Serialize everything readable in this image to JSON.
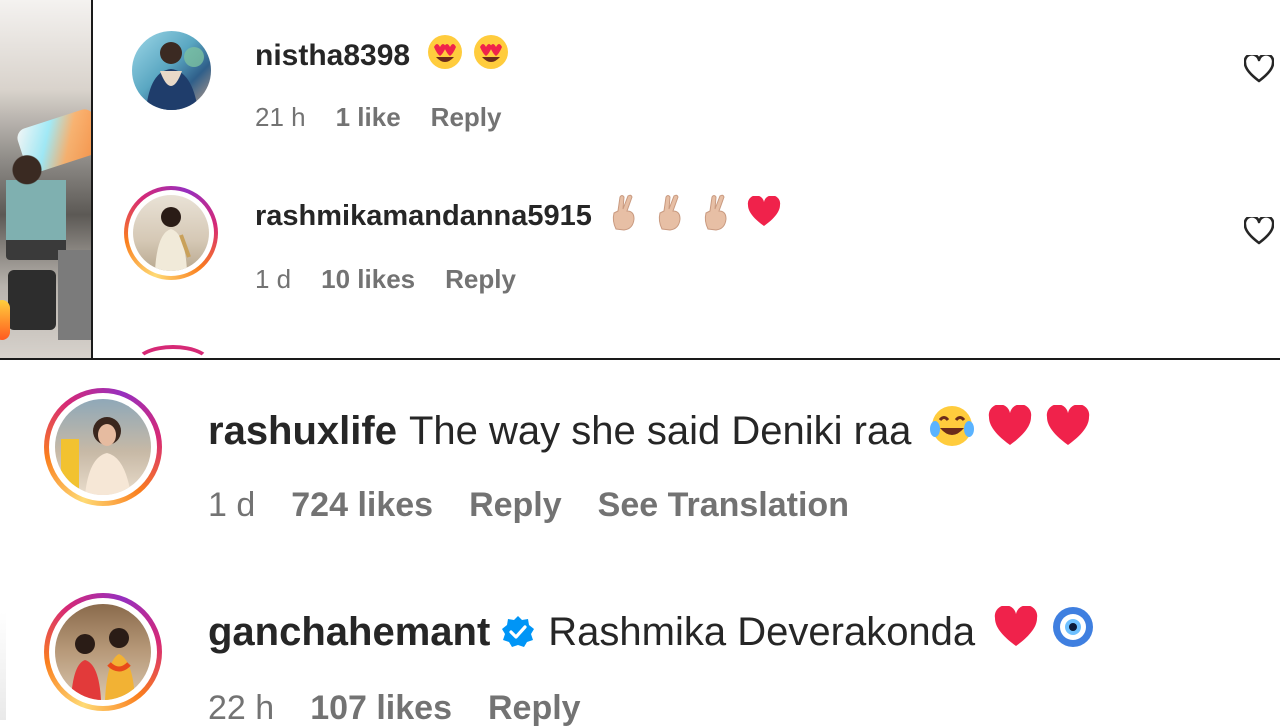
{
  "comments": [
    {
      "username": "nistha8398",
      "text": "",
      "emojis": [
        "heart-eyes-face",
        "heart-eyes-face"
      ],
      "time": "21 h",
      "likes": "1 like",
      "reply": "Reply"
    },
    {
      "username": "rashmikamandanna5915",
      "text": "",
      "emojis": [
        "crossed-fingers",
        "crossed-fingers",
        "crossed-fingers",
        "red-heart"
      ],
      "time": "1 d",
      "likes": "10 likes",
      "reply": "Reply"
    },
    {
      "username": "rashuxlife",
      "text": "The way she said Deniki raa",
      "emojis": [
        "tears-of-joy-face",
        "red-heart",
        "red-heart"
      ],
      "time": "1 d",
      "likes": "724 likes",
      "reply": "Reply",
      "translate": "See Translation"
    },
    {
      "username": "ganchahemant",
      "verified": true,
      "text": "Rashmika Deverakonda",
      "emojis": [
        "red-heart",
        "nazar-amulet"
      ],
      "time": "22 h",
      "likes": "107 likes",
      "reply": "Reply"
    }
  ],
  "colors": {
    "username": "#262626",
    "meta": "#737373",
    "story_ring": [
      "#feda75",
      "#fa7e1e",
      "#d62976",
      "#962fbf"
    ],
    "verified": "#0095f6",
    "heart_emoji": "#f0224b"
  },
  "icons": [
    "heart-outline-icon",
    "verified-badge-icon"
  ]
}
